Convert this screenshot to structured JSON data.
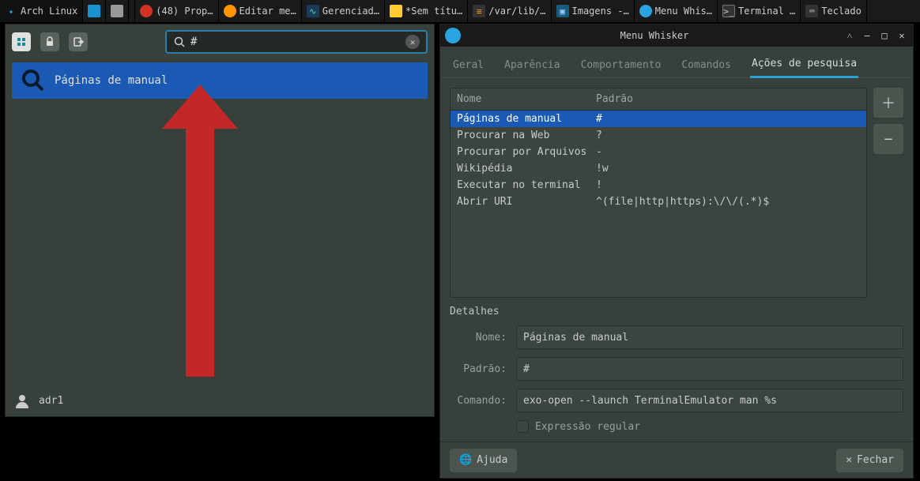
{
  "taskbar": {
    "items": [
      {
        "label": "Arch Linux",
        "icon": "arch"
      },
      {
        "label": "",
        "icon": "file"
      },
      {
        "label": "",
        "icon": "pane"
      },
      {
        "label": "",
        "icon": "sep"
      },
      {
        "label": "(48) Prop…",
        "icon": "brave"
      },
      {
        "label": "Editar me…",
        "icon": "firefox"
      },
      {
        "label": "Gerenciad…",
        "icon": "task"
      },
      {
        "label": "*Sem títu…",
        "icon": "note"
      },
      {
        "label": "/var/lib/…",
        "icon": "subl"
      },
      {
        "label": "Imagens -…",
        "icon": "img"
      },
      {
        "label": "Menu Whis…",
        "icon": "menu"
      },
      {
        "label": "Terminal …",
        "icon": "term"
      },
      {
        "label": "Teclado",
        "icon": "kbd"
      }
    ]
  },
  "whisker": {
    "search_value": "#",
    "result_label": "Páginas de manual",
    "user": "adr1"
  },
  "dialog": {
    "title": "Menu Whisker",
    "tabs": [
      "Geral",
      "Aparência",
      "Comportamento",
      "Comandos",
      "Ações de pesquisa"
    ],
    "active_tab": 4,
    "columns": {
      "name": "Nome",
      "pattern": "Padrão"
    },
    "rows": [
      {
        "name": "Páginas de manual",
        "pattern": "#"
      },
      {
        "name": "Procurar na Web",
        "pattern": "?"
      },
      {
        "name": "Procurar por Arquivos",
        "pattern": "-"
      },
      {
        "name": "Wikipédia",
        "pattern": "!w"
      },
      {
        "name": "Executar no terminal",
        "pattern": "!"
      },
      {
        "name": "Abrir URI",
        "pattern": "^(file|http|https):\\/\\/(.*)$"
      }
    ],
    "selected_row": 0,
    "details": {
      "section_label": "Detalhes",
      "name_label": "Nome:",
      "pattern_label": "Padrão:",
      "command_label": "Comando:",
      "name_value": "Páginas de manual",
      "pattern_value": "#",
      "command_value": "exo-open --launch TerminalEmulator man %s",
      "regex_label": "Expressão regular"
    },
    "help_label": "Ajuda",
    "close_label": "Fechar"
  }
}
